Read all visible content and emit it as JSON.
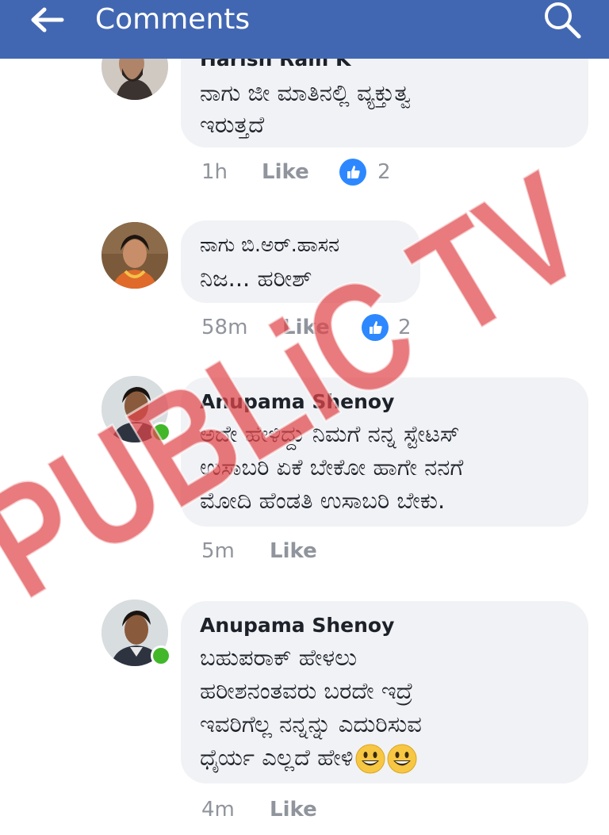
{
  "header": {
    "title": "Comments",
    "back_icon": "back-arrow-icon",
    "search_icon": "search-icon",
    "color": "#4267b2"
  },
  "comments": [
    {
      "author": "Harish Ram K",
      "lines": [
        "ನಾಗು ಜೀ ಮಾತಿನಲ್ಲಿ ವ್ಯಕ್ತುತ್ವ",
        "ಇರುತ್ತದೆ"
      ],
      "time": "1h",
      "like_label": "Like",
      "reactions": "2"
    },
    {
      "author": "ನಾಗು ಬಿ.ಅರ್.ಹಾಸನ",
      "lines": [
        "ನಿಜ... ಹರೀಶ್"
      ],
      "time": "58m",
      "like_label": "Like",
      "reactions": "2"
    },
    {
      "author": "Anupama Shenoy",
      "lines": [
        "ಅದೇ ಹೇಳಿದ್ದು ನಿಮಗೆ ನನ್ನ ಸ್ಟೇಟಸ್",
        "ಉಸಾಬರಿ ಏಕೆ ಬೇಕೋ ಹಾಗೇ ನನಗೆ",
        "ಮೋದಿ ಹೆಂಡತಿ ಉಸಾಬರಿ ಬೇಕು."
      ],
      "time": "5m",
      "like_label": "Like",
      "online": true
    },
    {
      "author": "Anupama Shenoy",
      "lines": [
        "ಬಹುಪರಾಕ್ ಹೇಳಲು",
        "ಹರೀಶನಂತವರು ಬರದೇ ಇದ್ರೆ",
        "ಇವರಿಗೆಲ್ಲ ನನ್ನನ್ನು ಎದುರಿಸುವ",
        "ಧೈರ್ಯ ಎಲ್ಲದೆ ಹೇಳಿ"
      ],
      "time": "4m",
      "like_label": "Like",
      "online": true
    }
  ],
  "watermark": {
    "text": "PUBLiC TV",
    "color": "#e0464b"
  },
  "colors": {
    "bubble": "#f1f2f5",
    "meta_text": "#90949c",
    "like_blue": "#2d88ff",
    "online_green": "#42b72a"
  }
}
